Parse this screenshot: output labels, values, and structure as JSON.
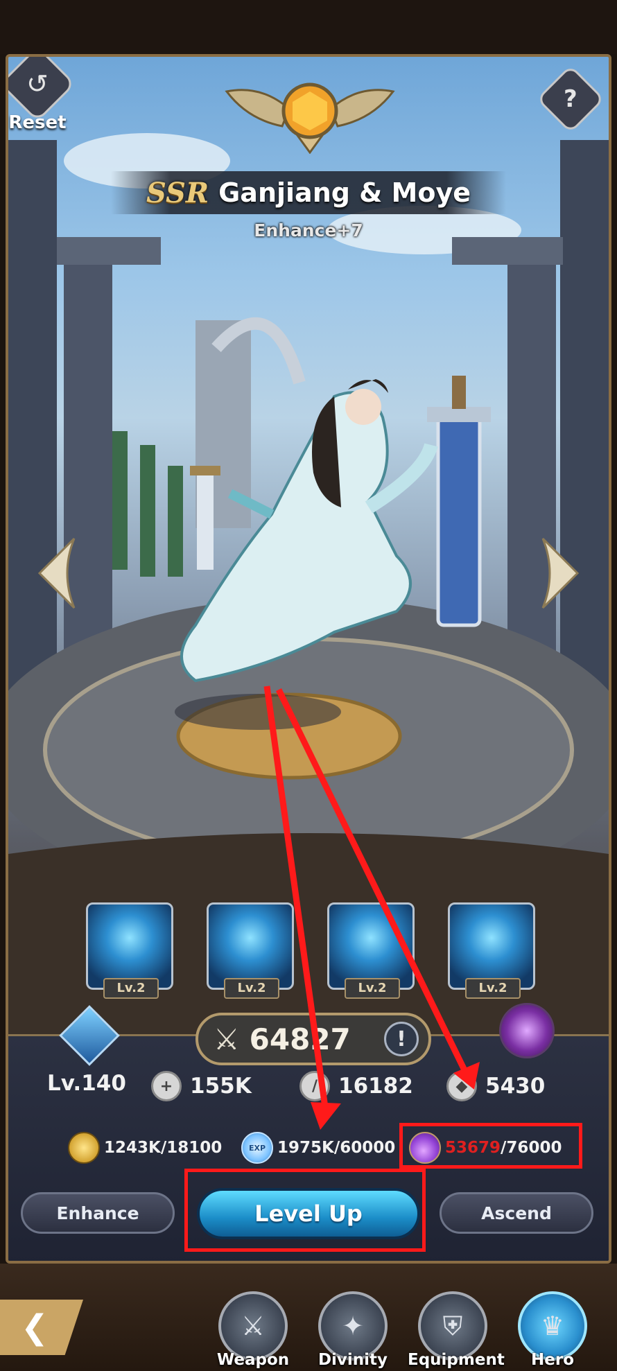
{
  "header": {
    "reset_label": "Reset",
    "help_label": "?",
    "rarity": "SSR",
    "hero_name": "Ganjiang & Moye",
    "enhance_level": "Enhance+7"
  },
  "skills": [
    {
      "level": "Lv.2"
    },
    {
      "level": "Lv.2"
    },
    {
      "level": "Lv.2"
    },
    {
      "level": "Lv.2"
    }
  ],
  "stats": {
    "power": "64827",
    "level": "Lv.140",
    "hp": "155K",
    "attack": "16182",
    "defense": "5430"
  },
  "resources": {
    "gold": "1243K/18100",
    "exp_icon_label": "EXP",
    "exp": "1975K/60000",
    "potion_current": "53679",
    "potion_total": "/76000"
  },
  "actions": {
    "enhance": "Enhance",
    "level_up": "Level Up",
    "ascend": "Ascend"
  },
  "bottom_nav": [
    {
      "label": "Weapon"
    },
    {
      "label": "Divinity"
    },
    {
      "label": "Equipment"
    },
    {
      "label": "Hero"
    }
  ],
  "colors": {
    "annotation": "#ff1a1a",
    "insufficient_resource": "#e02020",
    "primary_button": "#1b8dc8"
  }
}
